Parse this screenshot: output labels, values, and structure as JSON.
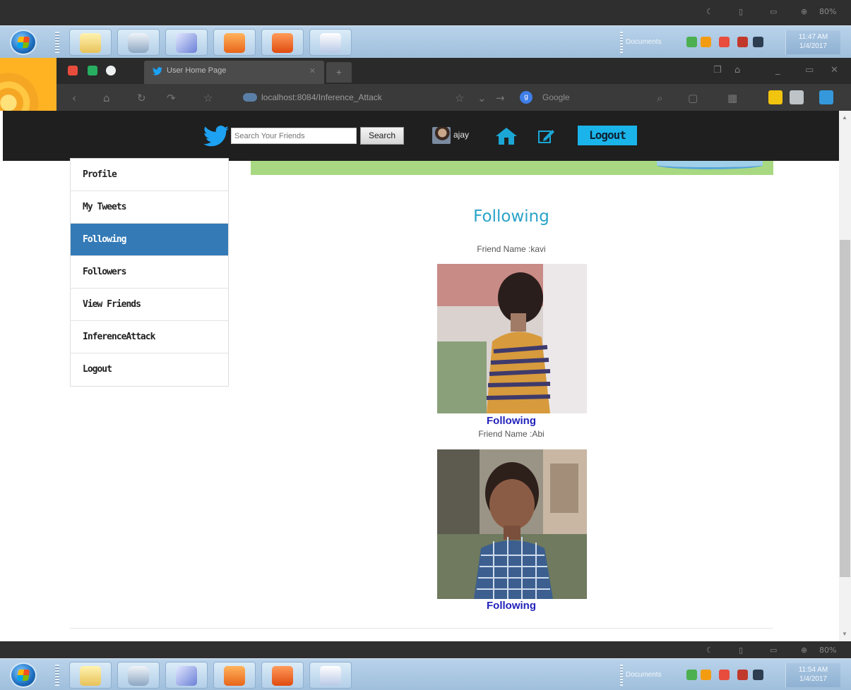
{
  "top_strip": {
    "zoom": "80%"
  },
  "taskbar_top": {
    "documents_label": "Documents",
    "time": "11:47 AM",
    "date": "1/4/2017"
  },
  "taskbar_bottom": {
    "documents_label": "Documents",
    "time": "11:54 AM",
    "date": "1/4/2017"
  },
  "browser": {
    "tab_title": "User Home Page",
    "url": "localhost:8084/Inference_Attack",
    "search_engine": "Google"
  },
  "header": {
    "search_placeholder": "Search Your Friends",
    "search_button": "Search",
    "username": "ajay",
    "logout_label": "Logout"
  },
  "sidebar": {
    "items": [
      {
        "label": "Profile",
        "active": false
      },
      {
        "label": "My Tweets",
        "active": false
      },
      {
        "label": "Following",
        "active": true
      },
      {
        "label": "Followers",
        "active": false
      },
      {
        "label": "View Friends",
        "active": false
      },
      {
        "label": "InferenceAttack",
        "active": false
      },
      {
        "label": "Logout",
        "active": false
      }
    ]
  },
  "main": {
    "heading": "Following",
    "friends": [
      {
        "name_label": "Friend Name :kavi",
        "action": "Following"
      },
      {
        "name_label": "Friend Name :Abi",
        "action": "Following"
      }
    ]
  },
  "colors": {
    "accent": "#337ab7",
    "heading": "#2aa3c9",
    "twitter": "#1da1f2",
    "logout": "#1ab4ea"
  }
}
